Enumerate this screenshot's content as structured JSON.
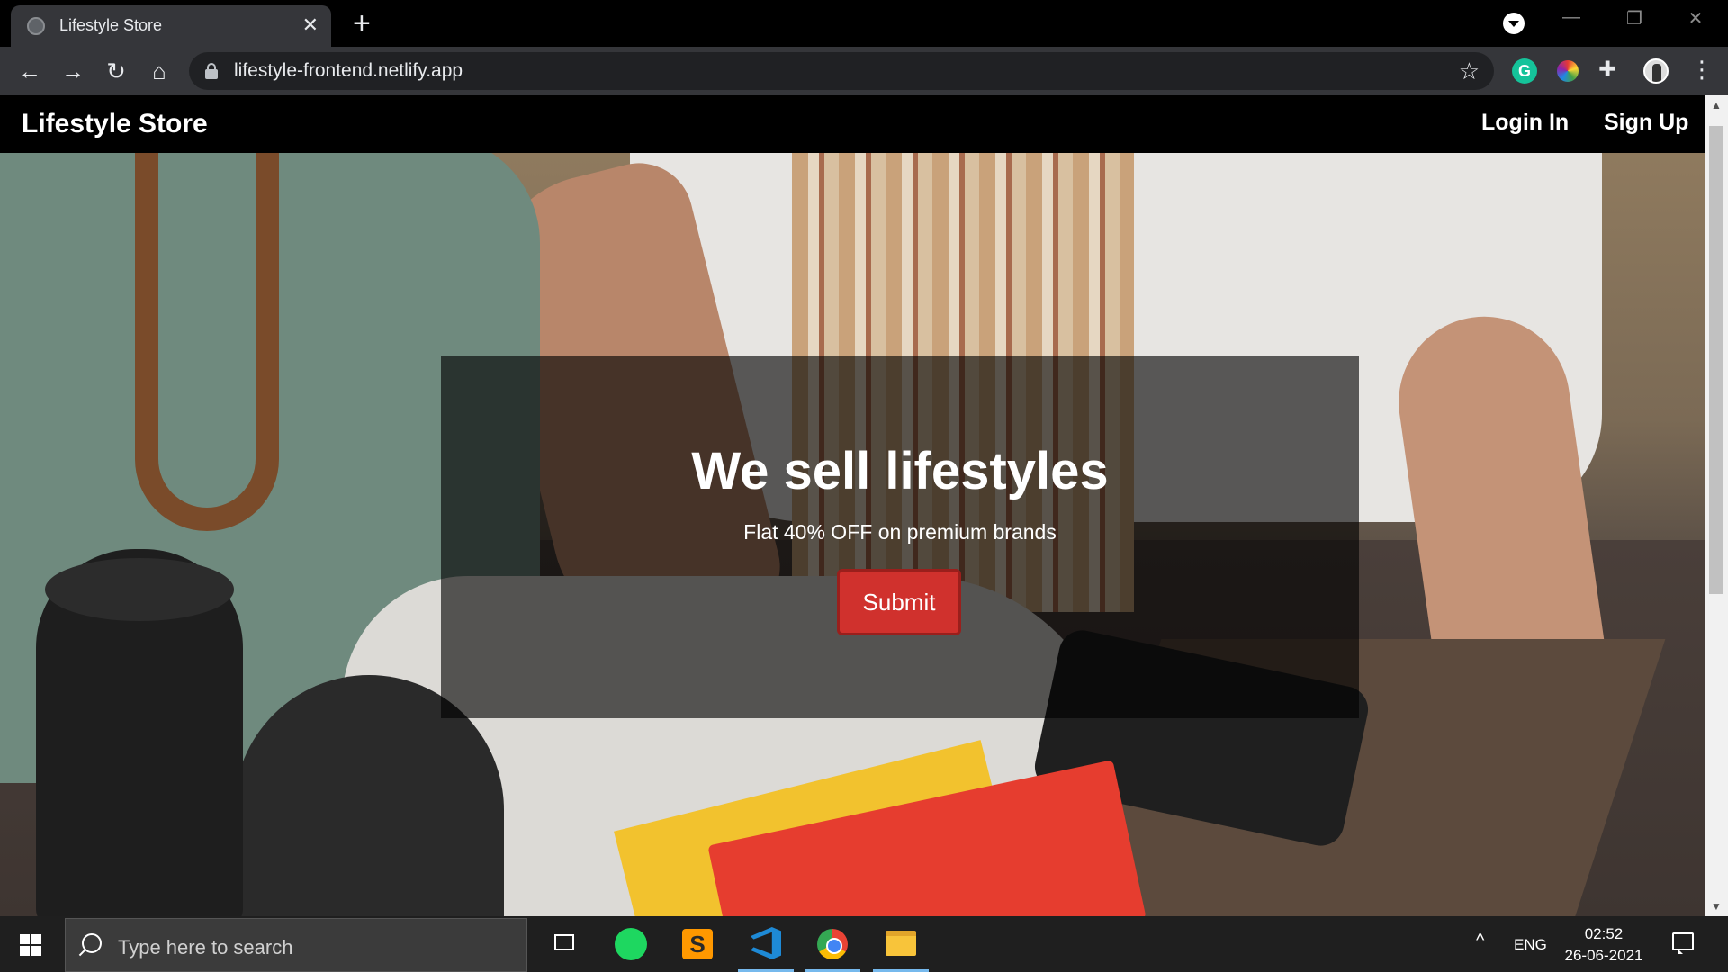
{
  "browser": {
    "tab_title": "Lifestyle Store",
    "tab_close": "✕",
    "new_tab": "+",
    "url": "lifestyle-frontend.netlify.app",
    "back": "←",
    "forward": "→",
    "reload": "↻",
    "home": "⌂",
    "star": "☆",
    "ext_grammarly": "G",
    "extensions": "✚",
    "menu": "⋮",
    "minimize": "—",
    "maximize": "❐",
    "close": "✕"
  },
  "site": {
    "brand": "Lifestyle Store",
    "nav_login": "Login In",
    "nav_signup": "Sign Up"
  },
  "hero": {
    "title": "We sell lifestyles",
    "subtitle": "Flat 40% OFF on premium brands",
    "button": "Submit"
  },
  "taskbar": {
    "search_placeholder": "Type here to search",
    "sublime_glyph": "S",
    "tray_chevron": "^",
    "language": "ENG",
    "time": "02:52",
    "date": "26-06-2021"
  },
  "colors": {
    "accent_button": "#d0312d",
    "navbar": "#000000",
    "overlay": "rgba(0,0,0,0.62)"
  }
}
